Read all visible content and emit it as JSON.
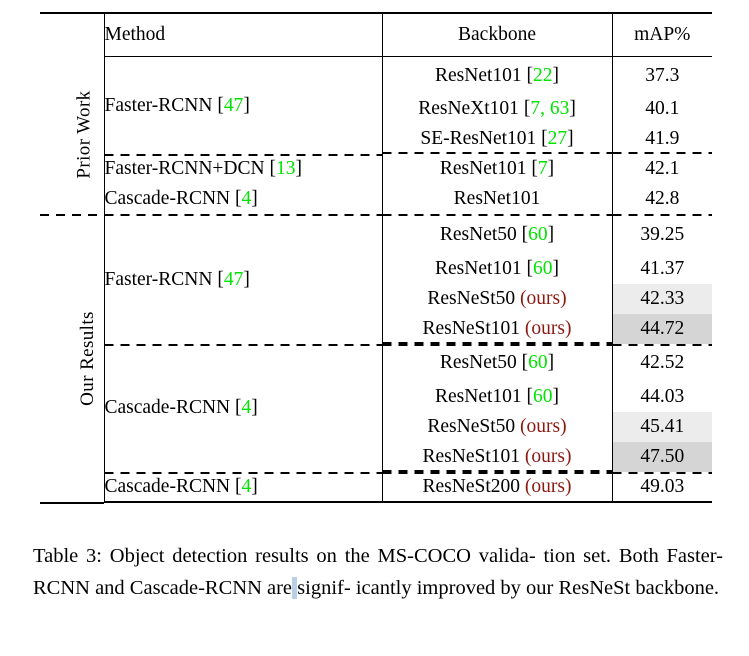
{
  "table": {
    "headers": {
      "group": "",
      "method": "Method",
      "backbone": "Backbone",
      "map": "mAP%"
    },
    "group_labels": {
      "prior": "Prior Work",
      "ours": "Our Results"
    },
    "colors": {
      "citation_green": "#00e400",
      "ours_red": "#8b1a12",
      "highlight_light": "#ececec",
      "highlight_dark": "#d5d5d5",
      "selection_blue": "#b8cfe8"
    },
    "rows": [
      {
        "group": "prior",
        "method": "Faster-RCNN",
        "method_cite": "47",
        "backbone": "ResNet101",
        "backbone_cite": "22",
        "map": "37.3",
        "highlight": "none",
        "bold": false
      },
      {
        "group": "prior",
        "method": "",
        "method_cite": "",
        "backbone": "ResNeXt101",
        "backbone_cite": "7, 63",
        "map": "40.1",
        "highlight": "none",
        "bold": false
      },
      {
        "group": "prior",
        "method": "",
        "method_cite": "",
        "backbone": "SE-ResNet101",
        "backbone_cite": "27",
        "map": "41.9",
        "highlight": "none",
        "bold": false
      },
      {
        "group": "prior",
        "method": "Faster-RCNN+DCN",
        "method_cite": "13",
        "backbone": "ResNet101",
        "backbone_cite": "7",
        "map": "42.1",
        "highlight": "none",
        "bold": false
      },
      {
        "group": "prior",
        "method": "Cascade-RCNN",
        "method_cite": "4",
        "backbone": "ResNet101",
        "backbone_cite": "",
        "map": "42.8",
        "highlight": "none",
        "bold": false
      },
      {
        "group": "ours",
        "method": "Faster-RCNN",
        "method_cite": "47",
        "backbone": "ResNet50",
        "backbone_cite": "60",
        "map": "39.25",
        "highlight": "none",
        "bold": false
      },
      {
        "group": "ours",
        "method": "",
        "method_cite": "",
        "backbone": "ResNet101",
        "backbone_cite": "60",
        "map": "41.37",
        "highlight": "none",
        "bold": false
      },
      {
        "group": "ours",
        "method": "",
        "method_cite": "",
        "backbone": "ResNeSt50",
        "backbone_ours": "(ours)",
        "backbone_cite": "",
        "map": "42.33",
        "highlight": "light",
        "bold": false
      },
      {
        "group": "ours",
        "method": "",
        "method_cite": "",
        "backbone": "ResNeSt101",
        "backbone_ours": "(ours)",
        "backbone_cite": "",
        "map": "44.72",
        "highlight": "dark",
        "bold": true
      },
      {
        "group": "ours",
        "method": "Cascade-RCNN",
        "method_cite": "4",
        "backbone": "ResNet50",
        "backbone_cite": "60",
        "map": "42.52",
        "highlight": "none",
        "bold": false
      },
      {
        "group": "ours",
        "method": "",
        "method_cite": "",
        "backbone": "ResNet101",
        "backbone_cite": "60",
        "map": "44.03",
        "highlight": "none",
        "bold": false
      },
      {
        "group": "ours",
        "method": "",
        "method_cite": "",
        "backbone": "ResNeSt50",
        "backbone_ours": "(ours)",
        "backbone_cite": "",
        "map": "45.41",
        "highlight": "light",
        "bold": false
      },
      {
        "group": "ours",
        "method": "",
        "method_cite": "",
        "backbone": "ResNeSt101",
        "backbone_ours": "(ours)",
        "backbone_cite": "",
        "map": "47.50",
        "highlight": "dark",
        "bold": true
      },
      {
        "group": "ours",
        "method": "Cascade-RCNN",
        "method_cite": "4",
        "backbone": "ResNeSt200",
        "backbone_ours": "(ours)",
        "backbone_cite": "",
        "map": "49.03",
        "highlight": "none",
        "bold": false
      }
    ]
  },
  "caption": {
    "label": "Table 3:",
    "line1": "Object detection results on the MS-COCO valida-",
    "line2a": "tion set. Both Faster-RCNN and Cascade-RCNN are",
    "line2_selected": " ",
    "line2b": "signif-",
    "line3": "icantly improved by our ResNeSt backbone."
  },
  "cells": {
    "method_faster_prior": "Faster-RCNN",
    "method_faster_ours": "Faster-RCNN",
    "method_cascade_ours": "Cascade-RCNN",
    "method_faster_dcn": "Faster-RCNN+DCN",
    "method_cascade_prior": "Cascade-RCNN",
    "method_cascade_last": "Cascade-RCNN"
  }
}
